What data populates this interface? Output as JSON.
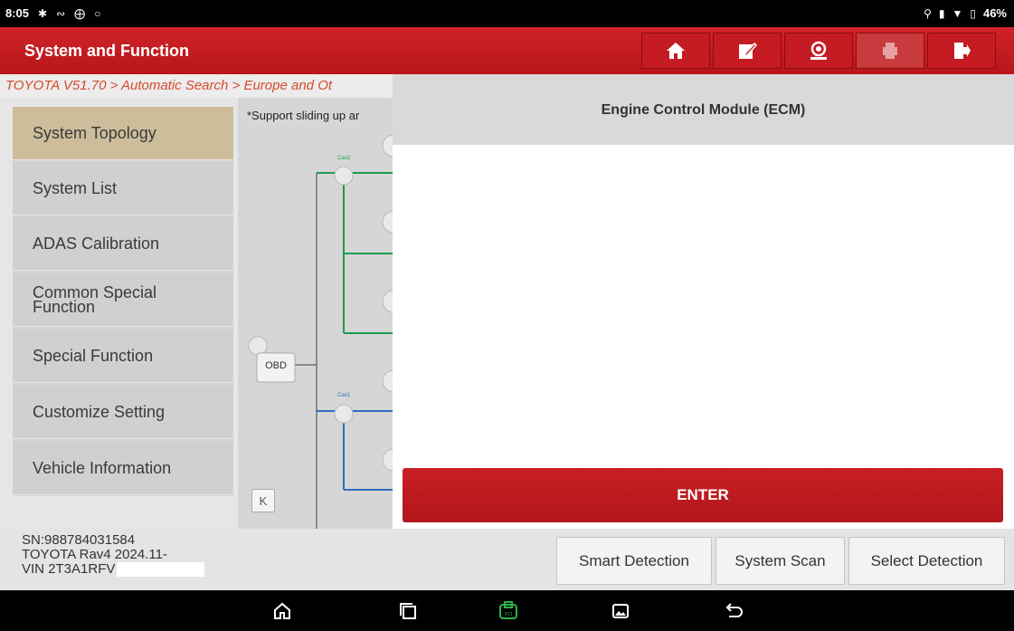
{
  "statusbar": {
    "time": "8:05",
    "battery": "46%",
    "left_icons": [
      "gear-icon",
      "voicemail-icon",
      "bluetooth-icon",
      "chat-icon"
    ],
    "right_icons": [
      "location-icon",
      "vibrate-icon",
      "wifi-icon",
      "battery-icon"
    ]
  },
  "header": {
    "title": "System and Function",
    "buttons": [
      {
        "name": "home-icon",
        "enabled": true
      },
      {
        "name": "edit-icon",
        "enabled": true
      },
      {
        "name": "support-icon",
        "enabled": true
      },
      {
        "name": "print-icon",
        "enabled": false
      },
      {
        "name": "exit-icon",
        "enabled": true
      }
    ]
  },
  "breadcrumb": "TOYOTA V51.70 > Automatic Search > Europe and Ot",
  "sidebar": {
    "items": [
      {
        "label": "System Topology",
        "active": true
      },
      {
        "label": "System List",
        "active": false
      },
      {
        "label": "ADAS Calibration",
        "active": false
      },
      {
        "label": "Common Special Function",
        "active": false
      },
      {
        "label": "Special Function",
        "active": false
      },
      {
        "label": "Customize Setting",
        "active": false
      },
      {
        "label": "Vehicle Information",
        "active": false
      }
    ]
  },
  "topology": {
    "hint": "*Support sliding up ar",
    "obd_label": "OBD",
    "bus1": "Can2",
    "bus2": "Can1",
    "collapse_symbol": "K"
  },
  "detail": {
    "module_name": "Engine Control Module (ECM)",
    "enter_label": "ENTER"
  },
  "vehicle": {
    "sn": "SN:988784031584",
    "model": "TOYOTA Rav4 2024.11-",
    "vin": "VIN 2T3A1RFV"
  },
  "bottom_buttons": {
    "smart_detection": "Smart Detection",
    "system_scan": "System Scan",
    "select_detection": "Select Detection"
  },
  "colors": {
    "brand_red": "#c41c22",
    "active_item": "#cdbd9a",
    "bus_green": "#1e9a4f",
    "bus_blue": "#2c6fbf"
  }
}
